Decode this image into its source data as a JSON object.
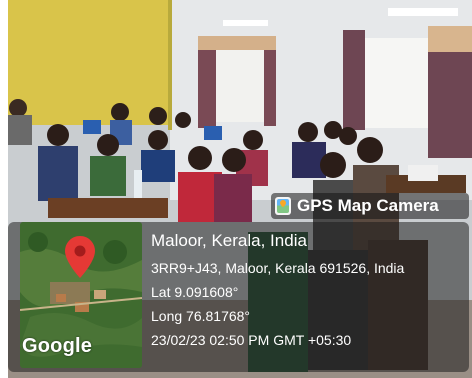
{
  "watermark": {
    "app_name": "GPS Map Camera",
    "app_icon": "gps-map-camera-icon",
    "map_logo": "Google",
    "location_title": "Maloor, Kerala, India",
    "address": "3RR9+J43, Maloor, Kerala 691526, India",
    "latitude": "Lat 9.091608°",
    "longitude": "Long 76.81768°",
    "datetime": "23/02/23 02:50 PM GMT +05:30",
    "pin_color": "#e53935"
  }
}
